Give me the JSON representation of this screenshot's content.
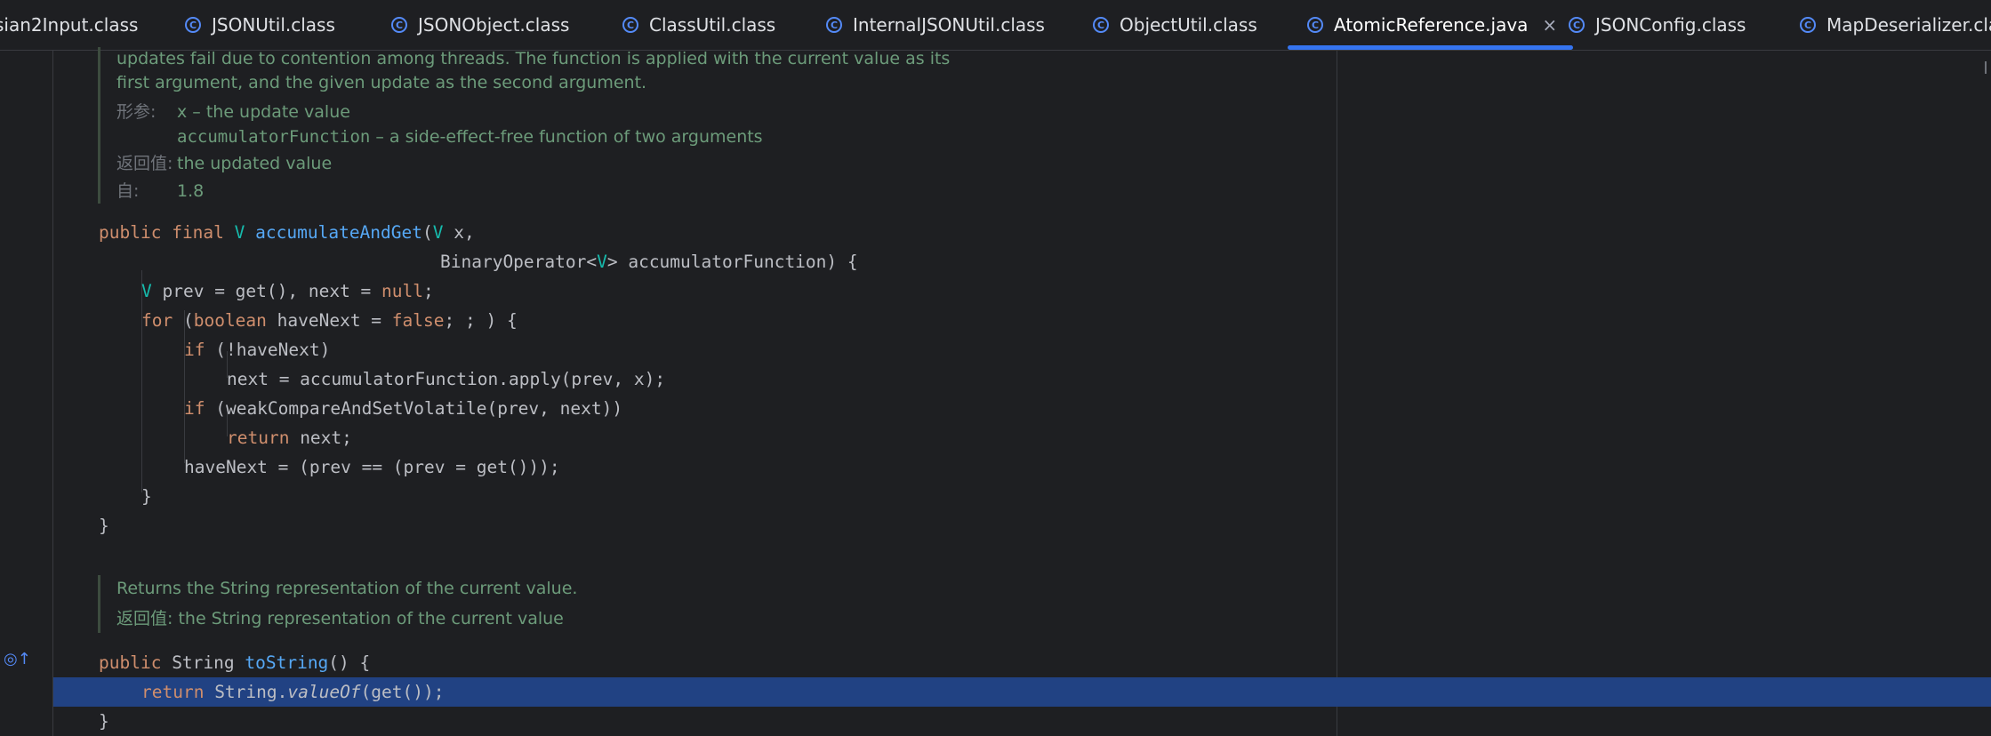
{
  "tabs": [
    {
      "label": "sian2Input.class",
      "icon": "C"
    },
    {
      "label": "JSONUtil.class",
      "icon": "C"
    },
    {
      "label": "JSONObject.class",
      "icon": "C"
    },
    {
      "label": "ClassUtil.class",
      "icon": "C"
    },
    {
      "label": "InternalJSONUtil.class",
      "icon": "C"
    },
    {
      "label": "ObjectUtil.class",
      "icon": "C"
    },
    {
      "label": "AtomicReference.java",
      "icon": "C",
      "close": "×"
    },
    {
      "label": "JSONConfig.class",
      "icon": "C"
    },
    {
      "label": "MapDeserializer.clas",
      "icon": "C"
    }
  ],
  "doc1": {
    "line1": "updates fail due to contention among threads. The function is applied with the current value as its",
    "line2": "first argument, and the given update as the second argument.",
    "params_tag": "形参:",
    "param1": "x – the update value",
    "param2_name": "accumulatorFunction",
    "param2_desc": " – a side-effect-free function of two arguments",
    "returns_tag": "返回值:",
    "returns": "the updated value",
    "since_tag": "自:",
    "since": "1.8"
  },
  "code1": {
    "l1": {
      "kw1": "public",
      "kw2": "final",
      "type": "V",
      "name": "accumulateAndGet",
      "open": "(",
      "ptype": "V",
      "rest": " x,"
    },
    "l2": {
      "a": "BinaryOperator<",
      "t": "V",
      "b": "> accumulatorFunction) {"
    },
    "l3": {
      "t": "V",
      "a": " prev = get(), next = ",
      "k": "null",
      "b": ";"
    },
    "l4": {
      "k1": "for",
      "a": " (",
      "k2": "boolean",
      "b": " haveNext = ",
      "k3": "false",
      "c": "; ; ) {"
    },
    "l5": {
      "k": "if",
      "a": " (!haveNext)"
    },
    "l6": "next = accumulatorFunction.apply(prev, x);",
    "l7": {
      "k": "if",
      "a": " (weakCompareAndSetVolatile(prev, next))"
    },
    "l8": {
      "k": "return",
      "a": " next;"
    },
    "l9": "haveNext = (prev == (prev = get()));",
    "l10": "}",
    "l11": "}"
  },
  "doc2": {
    "line1": "Returns the String representation of the current value.",
    "returns_tag": "返回值:",
    "returns": "the String representation of the current value"
  },
  "code2": {
    "l1": {
      "kw": "public",
      "a": " String ",
      "name": "toString",
      "b": "() {"
    },
    "l2": {
      "kw": "return",
      "a": " String.",
      "m": "valueOf",
      "b": "(get());"
    },
    "l3": "}"
  },
  "gutter_marker": "◎↑",
  "colors": {
    "accent": "#3574f0",
    "selection": "#214283",
    "keyword": "#cf8e6d",
    "doc": "#6c9b7a"
  }
}
